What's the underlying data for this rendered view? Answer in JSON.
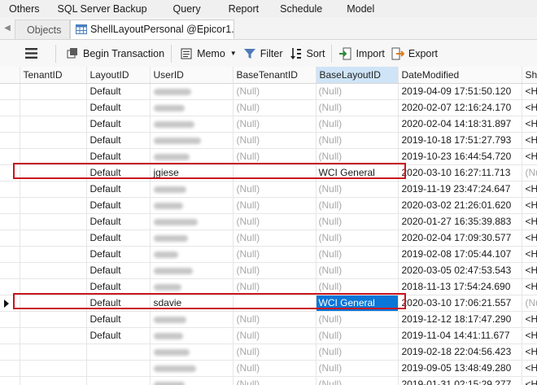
{
  "menu": [
    "Others",
    "SQL Server Backup",
    "Query",
    "Report",
    "Schedule",
    "Model"
  ],
  "tabs": {
    "objects_label": "Objects",
    "active_label": "ShellLayoutPersonal @Epicor1...",
    "active_icon": "table-icon"
  },
  "toolbar": {
    "begin_transaction": "Begin Transaction",
    "memo": "Memo",
    "filter": "Filter",
    "sort": "Sort",
    "import": "Import",
    "export": "Export"
  },
  "grid": {
    "columns": [
      "TenantID",
      "LayoutID",
      "UserID",
      "BaseTenantID",
      "BaseLayoutID",
      "DateModified",
      "Shel"
    ],
    "rows": [
      {
        "layout": "Default",
        "user": "",
        "base_tenant": "(Null)",
        "base_layout": "(Null)",
        "date": "2019-04-09 17:51:50.120",
        "shell": "<Ho"
      },
      {
        "layout": "Default",
        "user": "",
        "base_tenant": "(Null)",
        "base_layout": "(Null)",
        "date": "2020-02-07 12:16:24.170",
        "shell": "<Ho"
      },
      {
        "layout": "Default",
        "user": "",
        "base_tenant": "(Null)",
        "base_layout": "(Null)",
        "date": "2020-02-04 14:18:31.897",
        "shell": "<Ho"
      },
      {
        "layout": "Default",
        "user": "",
        "base_tenant": "(Null)",
        "base_layout": "(Null)",
        "date": "2019-10-18 17:51:27.793",
        "shell": "<Ho"
      },
      {
        "layout": "Default",
        "user": "",
        "base_tenant": "(Null)",
        "base_layout": "(Null)",
        "date": "2019-10-23 16:44:54.720",
        "shell": "<Ho"
      },
      {
        "layout": "Default",
        "user": "jgiese",
        "base_tenant": "",
        "base_layout": "WCI General",
        "date": "2020-03-10 16:27:11.713",
        "shell": "(Nu"
      },
      {
        "layout": "Default",
        "user": "",
        "base_tenant": "(Null)",
        "base_layout": "(Null)",
        "date": "2019-11-19 23:47:24.647",
        "shell": "<Ho"
      },
      {
        "layout": "Default",
        "user": "",
        "base_tenant": "(Null)",
        "base_layout": "(Null)",
        "date": "2020-03-02 21:26:01.620",
        "shell": "<Ho"
      },
      {
        "layout": "Default",
        "user": "",
        "base_tenant": "(Null)",
        "base_layout": "(Null)",
        "date": "2020-01-27 16:35:39.883",
        "shell": "<Ho"
      },
      {
        "layout": "Default",
        "user": "",
        "base_tenant": "(Null)",
        "base_layout": "(Null)",
        "date": "2020-02-04 17:09:30.577",
        "shell": "<Ho"
      },
      {
        "layout": "Default",
        "user": "",
        "base_tenant": "(Null)",
        "base_layout": "(Null)",
        "date": "2019-02-08 17:05:44.107",
        "shell": "<Ho"
      },
      {
        "layout": "Default",
        "user": "",
        "base_tenant": "(Null)",
        "base_layout": "(Null)",
        "date": "2020-03-05 02:47:53.543",
        "shell": "<Ho"
      },
      {
        "layout": "Default",
        "user": "",
        "base_tenant": "(Null)",
        "base_layout": "(Null)",
        "date": "2018-11-13 17:54:24.690",
        "shell": "<Ho"
      },
      {
        "layout": "Default",
        "user": "sdavie",
        "base_tenant": "",
        "base_layout": "WCI General",
        "date": "2020-03-10 17:06:21.557",
        "shell": "(Nu"
      },
      {
        "layout": "Default",
        "user": "",
        "base_tenant": "(Null)",
        "base_layout": "(Null)",
        "date": "2019-12-12 18:17:47.290",
        "shell": "<Ho"
      },
      {
        "layout": "Default",
        "user": "",
        "base_tenant": "(Null)",
        "base_layout": "(Null)",
        "date": "2019-11-04 14:41:11.677",
        "shell": "<Ho"
      },
      {
        "layout": "",
        "user": "",
        "base_tenant": "(Null)",
        "base_layout": "(Null)",
        "date": "2019-02-18 22:04:56.423",
        "shell": "<Ho"
      },
      {
        "layout": "",
        "user": "",
        "base_tenant": "(Null)",
        "base_layout": "(Null)",
        "date": "2019-09-05 13:48:49.280",
        "shell": "<Ho"
      },
      {
        "layout": "",
        "user": "",
        "base_tenant": "(Null)",
        "base_layout": "(Null)",
        "date": "2019-01-31 02:15:29.277",
        "shell": "<Ho"
      }
    ],
    "current_row_index": 13,
    "selected_cell": {
      "row": 13,
      "column": "BaseLayoutID"
    },
    "highlighted_rows": [
      5,
      13
    ]
  },
  "colors": {
    "selection": "#0a76d8",
    "header_selected": "#cfe4f7",
    "highlight_box": "#c8161e",
    "null_text": "#a8a8a8"
  }
}
